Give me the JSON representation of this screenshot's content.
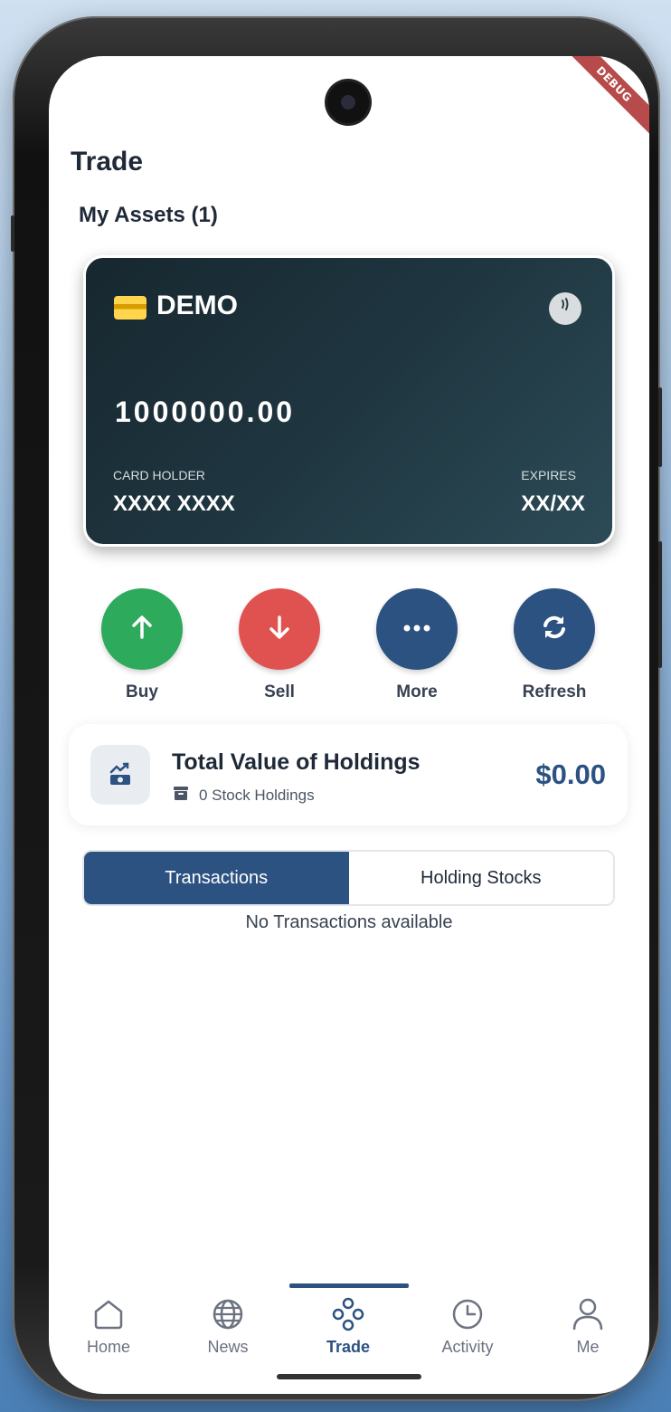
{
  "page": {
    "title": "Trade"
  },
  "debug_banner": "DEBUG",
  "assets": {
    "title": "My Assets (1)"
  },
  "card": {
    "name": "DEMO",
    "balance": "1000000.00",
    "holder_label": "CARD HOLDER",
    "holder_value": "XXXX XXXX",
    "expires_label": "EXPIRES",
    "expires_value": "XX/XX",
    "icons": [
      "credit-card-icon",
      "contactless-icon"
    ]
  },
  "actions": [
    {
      "label": "Buy",
      "icon": "arrow-up-icon",
      "color": "#2daa5c"
    },
    {
      "label": "Sell",
      "icon": "arrow-down-icon",
      "color": "#e0524f"
    },
    {
      "label": "More",
      "icon": "more-dots-icon",
      "color": "#2c5282"
    },
    {
      "label": "Refresh",
      "icon": "refresh-icon",
      "color": "#2c5282"
    }
  ],
  "holdings": {
    "title": "Total Value of Holdings",
    "subtitle": "0 Stock Holdings",
    "value": "$0.00",
    "icons": [
      "money-chart-icon",
      "archive-icon"
    ]
  },
  "tabs": [
    {
      "label": "Transactions",
      "active": true
    },
    {
      "label": "Holding Stocks",
      "active": false
    }
  ],
  "empty_message": "No Transactions available",
  "nav": [
    {
      "label": "Home",
      "icon": "home-icon",
      "active": false
    },
    {
      "label": "News",
      "icon": "globe-icon",
      "active": false
    },
    {
      "label": "Trade",
      "icon": "trade-icon",
      "active": true
    },
    {
      "label": "Activity",
      "icon": "clock-icon",
      "active": false
    },
    {
      "label": "Me",
      "icon": "person-icon",
      "active": false
    }
  ],
  "colors": {
    "primary": "#2c5282",
    "buy": "#2daa5c",
    "sell": "#e0524f",
    "card_dark": "#17272f"
  }
}
